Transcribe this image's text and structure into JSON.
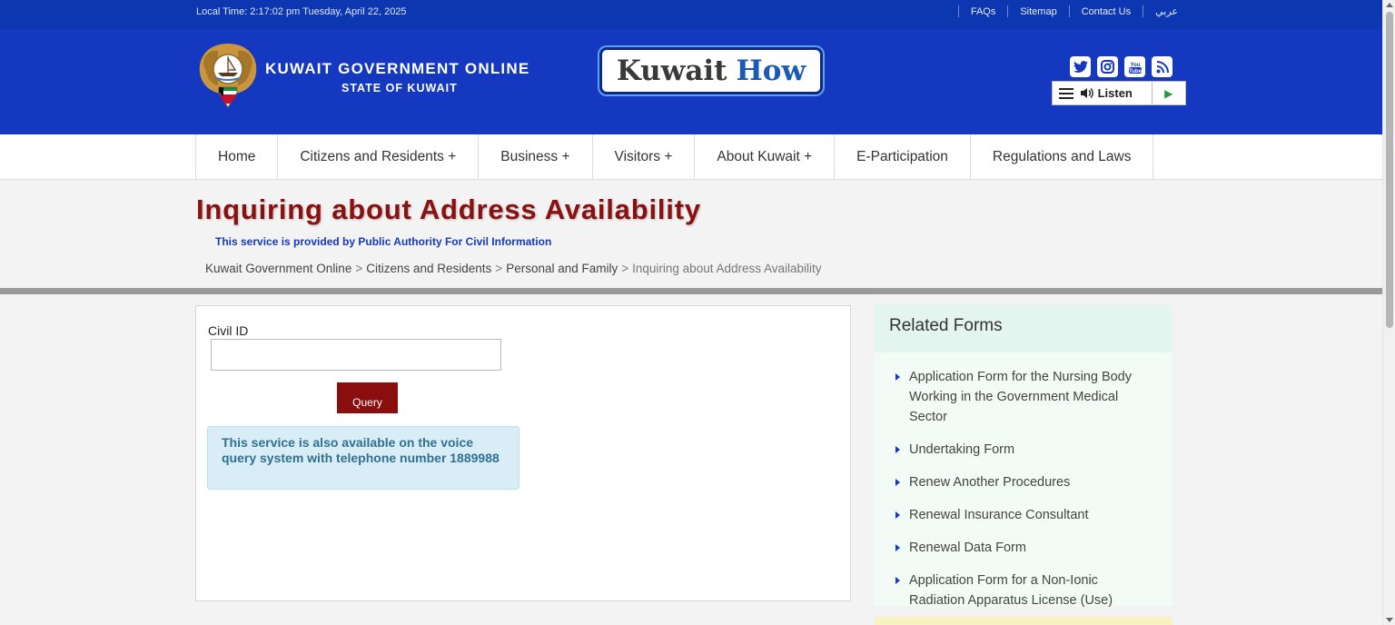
{
  "topbar": {
    "local_time": "Local Time: 2:17:02 pm Tuesday, April 22, 2025",
    "links": [
      "FAQs",
      "Sitemap",
      "Contact Us",
      "عربي"
    ]
  },
  "header": {
    "brand_title": "KUWAIT GOVERNMENT ONLINE",
    "brand_subtitle": "STATE OF KUWAIT",
    "kuwaithow_word1": "Kuwait",
    "kuwaithow_word2": "How",
    "social_icons": [
      "twitter-icon",
      "instagram-icon",
      "youtube-icon",
      "rss-icon"
    ],
    "listen_label": "Listen"
  },
  "nav": {
    "items": [
      "Home",
      "Citizens and Residents +",
      "Business +",
      "Visitors +",
      "About Kuwait +",
      "E-Participation",
      "Regulations and Laws"
    ]
  },
  "page": {
    "title": "Inquiring about Address Availability",
    "provider": "This service is provided by Public Authority For Civil Information",
    "breadcrumb": [
      "Kuwait Government Online",
      "Citizens and Residents",
      "Personal and Family",
      "Inquiring about Address Availability"
    ]
  },
  "form": {
    "civil_id_label": "Civil ID",
    "civil_id_value": "",
    "query_label": "Query",
    "info_text": "This service is also available on the voice query system with telephone number 1889988"
  },
  "related": {
    "heading": "Related Forms",
    "items": [
      "Application Form for the Nursing Body Working in the Government Medical Sector",
      "Undertaking Form",
      "Renew Another Procedures",
      "Renewal Insurance Consultant",
      "Renewal Data Form",
      "Application Form for a Non-Ionic Radiation Apparatus License (Use)"
    ]
  },
  "colors": {
    "topbar": "#0d37b0",
    "header": "#1439c0",
    "title": "#8b1010",
    "query_button": "#8b0e0e",
    "info_box": "#d9edf7"
  }
}
